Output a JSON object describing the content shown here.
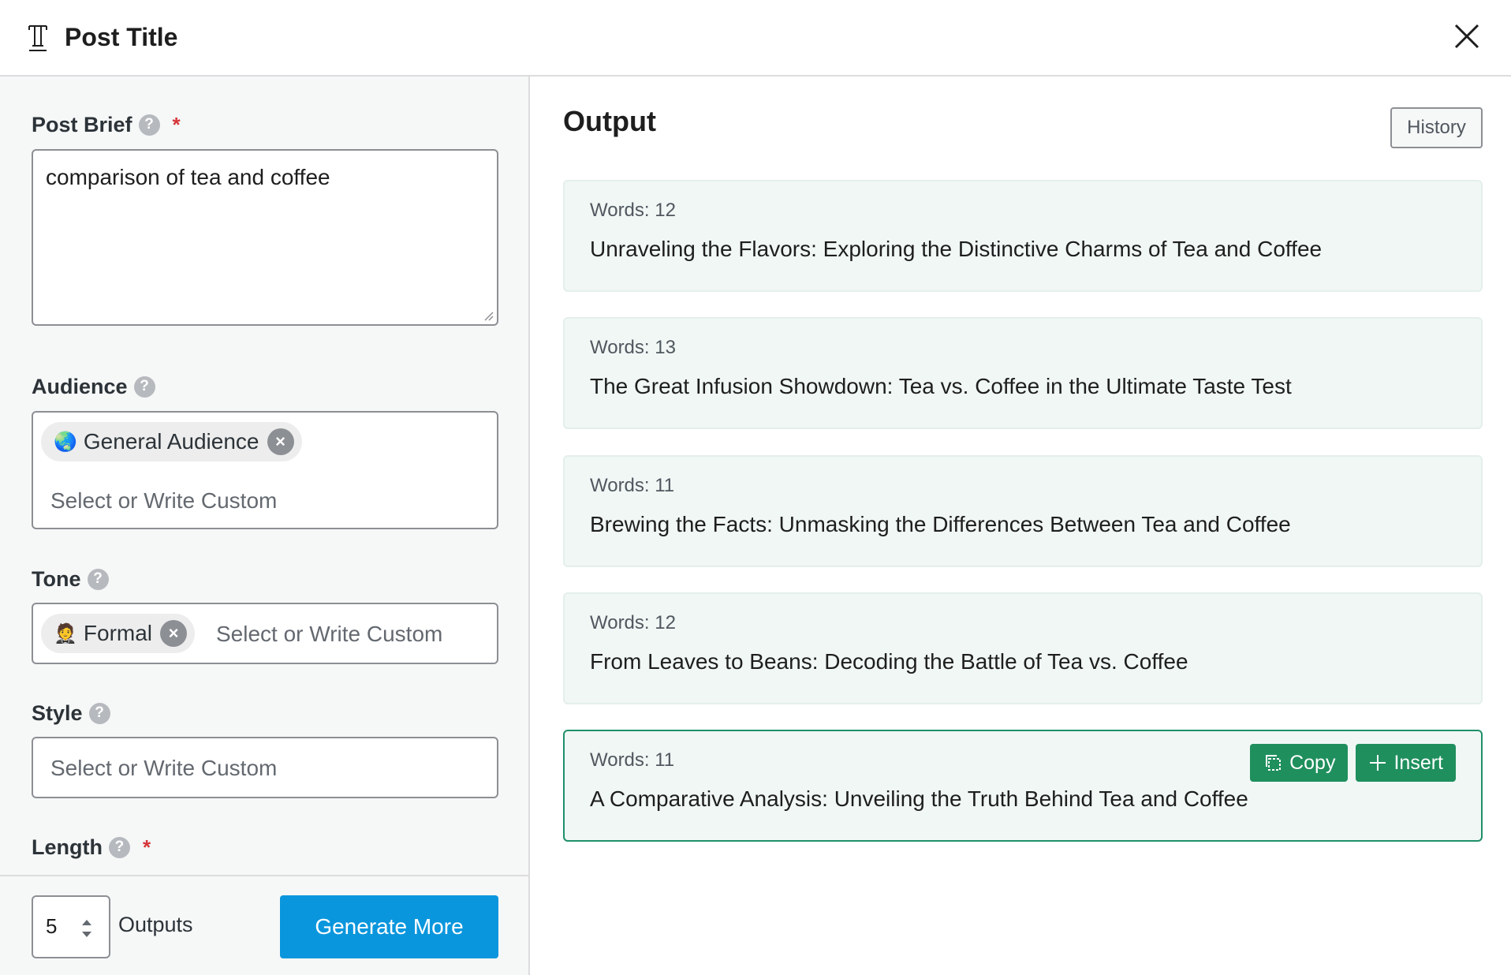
{
  "header": {
    "title": "Post Title",
    "title_icon": "text-format-icon",
    "close_icon": "close-icon"
  },
  "form": {
    "post_brief": {
      "label": "Post Brief",
      "required_mark": "*",
      "value": "comparison of tea and coffee"
    },
    "audience": {
      "label": "Audience",
      "chip": {
        "emoji": "🌏",
        "label": "General Audience"
      },
      "placeholder": "Select or Write Custom"
    },
    "tone": {
      "label": "Tone",
      "chip": {
        "emoji": "🤵",
        "label": "Formal"
      },
      "placeholder": "Select or Write Custom"
    },
    "style": {
      "label": "Style",
      "placeholder": "Select or Write Custom"
    },
    "length": {
      "label": "Length",
      "required_mark": "*"
    },
    "help_glyph": "?"
  },
  "footer": {
    "outputs_count": "5",
    "outputs_label": "Outputs",
    "generate_label": "Generate More"
  },
  "output": {
    "title": "Output",
    "history_label": "History",
    "copy_label": "Copy",
    "insert_label": "Insert",
    "results": [
      {
        "words": "Words: 12",
        "text": "Unraveling the Flavors: Exploring the Distinctive Charms of Tea and Coffee"
      },
      {
        "words": "Words: 13",
        "text": "The Great Infusion Showdown: Tea vs. Coffee in the Ultimate Taste Test"
      },
      {
        "words": "Words: 11",
        "text": "Brewing the Facts: Unmasking the Differences Between Tea and Coffee"
      },
      {
        "words": "Words: 12",
        "text": "From Leaves to Beans: Decoding the Battle of Tea vs. Coffee"
      },
      {
        "words": "Words: 11",
        "text": "A Comparative Analysis: Unveiling the Truth Behind Tea and Coffee"
      }
    ]
  },
  "colors": {
    "primary_blue": "#0a96dd",
    "action_green": "#1f8f5d",
    "card_bg": "#f0f7f5",
    "required_red": "#d63638"
  }
}
